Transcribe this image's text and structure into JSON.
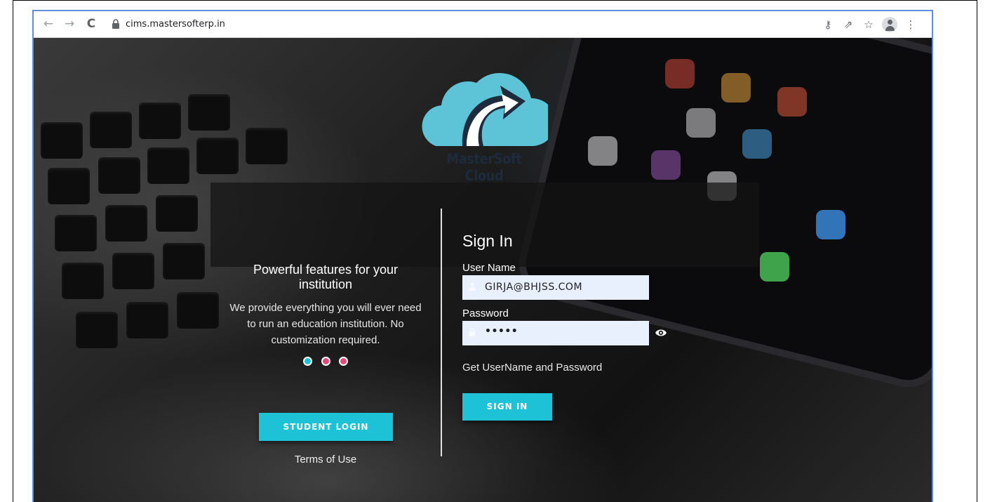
{
  "browser": {
    "url": "cims.mastersofterp.in",
    "back_glyph": "←",
    "forward_glyph": "→",
    "reload_glyph": "C",
    "key_glyph": "⚷",
    "share_glyph": "⇗",
    "star_glyph": "☆",
    "menu_glyph": "⋮"
  },
  "brand": {
    "name": "MasterSoft Cloud",
    "logo_color": "#5dc3d6",
    "text_color": "#1c2b3e"
  },
  "promo": {
    "headline": "Powerful features for your institution",
    "description": "We provide everything you will ever need to run an education institution. No customization required.",
    "dot_colors": [
      "#1ec2d6",
      "#e6487a",
      "#e6487a"
    ],
    "student_login_label": "STUDENT LOGIN",
    "terms_label": "Terms of Use"
  },
  "signin": {
    "title": "Sign In",
    "username_label": "User Name",
    "username_value": "GIRJA@BHJSS.COM",
    "password_label": "Password",
    "password_value": "•••••",
    "get_credentials_label": "Get UserName and Password",
    "button_label": "SIGN IN",
    "accent": "#1ec2d6"
  }
}
